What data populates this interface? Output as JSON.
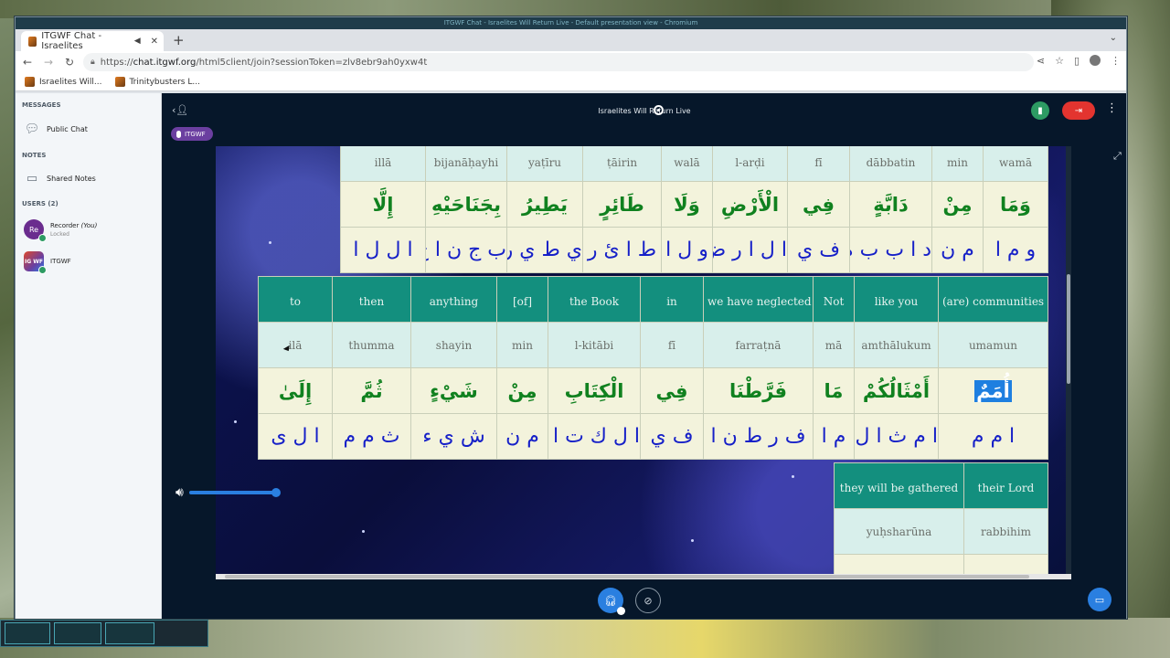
{
  "window": {
    "title": "ITGWF Chat - Israelites Will Return Live - Default presentation view - Chromium"
  },
  "browser": {
    "tab_title": "ITGWF Chat - Israelites",
    "url_prefix": "https://",
    "url_host": "chat.itgwf.org",
    "url_path": "/html5client/join?sessionToken=zlv8ebr9ah0yxw4t",
    "bookmarks": [
      "Israelites Will...",
      "Trinitybusters L..."
    ]
  },
  "sidebar": {
    "messages_title": "MESSAGES",
    "public_chat": "Public Chat",
    "notes_title": "NOTES",
    "shared_notes": "Shared Notes",
    "users_title": "USERS (2)",
    "users": [
      {
        "initials": "Re",
        "name": "Recorder",
        "tag": "(You)",
        "status": "Locked"
      },
      {
        "initials": "IG WF",
        "name": "ITGWF"
      }
    ]
  },
  "topbar": {
    "meeting_name": "Israelites Will Return Live",
    "talker_pill": "ITGWF"
  },
  "slide": {
    "top_table": {
      "translit": [
        "illā",
        "bijanāḥayhi",
        "yaṭīru",
        "ṭāirin",
        "walā",
        "l-arḍi",
        "fī",
        "dābbatin",
        "min",
        "wamā"
      ],
      "arabic": [
        "إِلَّا",
        "بِجَنَاحَيْهِ",
        "يَطِيرُ",
        "طَائِرٍ",
        "وَلَا",
        "الْأَرْضِ",
        "فِي",
        "دَابَّةٍ",
        "مِنْ",
        "وَمَا"
      ],
      "letters": [
        "ا ل ل ا",
        "ب ج ن ا ح ي ه",
        "ي ط ي ر",
        "ط ا ئ ر",
        "و ل ا",
        "ا ل ا ر ض",
        "ف ي",
        "د ا ب ب ة",
        "م ن",
        "و م ا"
      ]
    },
    "mid_table": {
      "english": [
        "to",
        "then",
        "anything",
        "[of]",
        "the Book",
        "in",
        "we have neglected",
        "Not",
        "like you",
        "(are) communities"
      ],
      "translit": [
        "ilā",
        "thumma",
        "shayin",
        "min",
        "l-kitābi",
        "fī",
        "farraṭnā",
        "mā",
        "amthālukum",
        "umamun"
      ],
      "arabic": [
        "إِلَىٰ",
        "ثُمَّ",
        "شَيْءٍ",
        "مِنْ",
        "الْكِتَابِ",
        "فِي",
        "فَرَّطْنَا",
        "مَا",
        "أَمْثَالُكُمْ",
        "أُمَمٌ"
      ],
      "letters": [
        "ا ل ى",
        "ث م م",
        "ش ي ء",
        "م ن",
        "ا ل ك ت ا ب",
        "ف ي",
        "ف ر ط ن ا",
        "م ا",
        "ا م ث ا ل ك م",
        "ا م م"
      ]
    },
    "bottom_table": {
      "english": [
        "they will be gathered",
        "their Lord"
      ],
      "translit": [
        "yuḥsharūna",
        "rabbihim"
      ]
    }
  },
  "colors": {
    "header_teal": "#138f7e",
    "translit_bg": "#d8efeb",
    "arabic_green": "#10811f",
    "letters_blue": "#1620c8",
    "leave_red": "#e3342f",
    "accent_blue": "#2a7fe0"
  }
}
